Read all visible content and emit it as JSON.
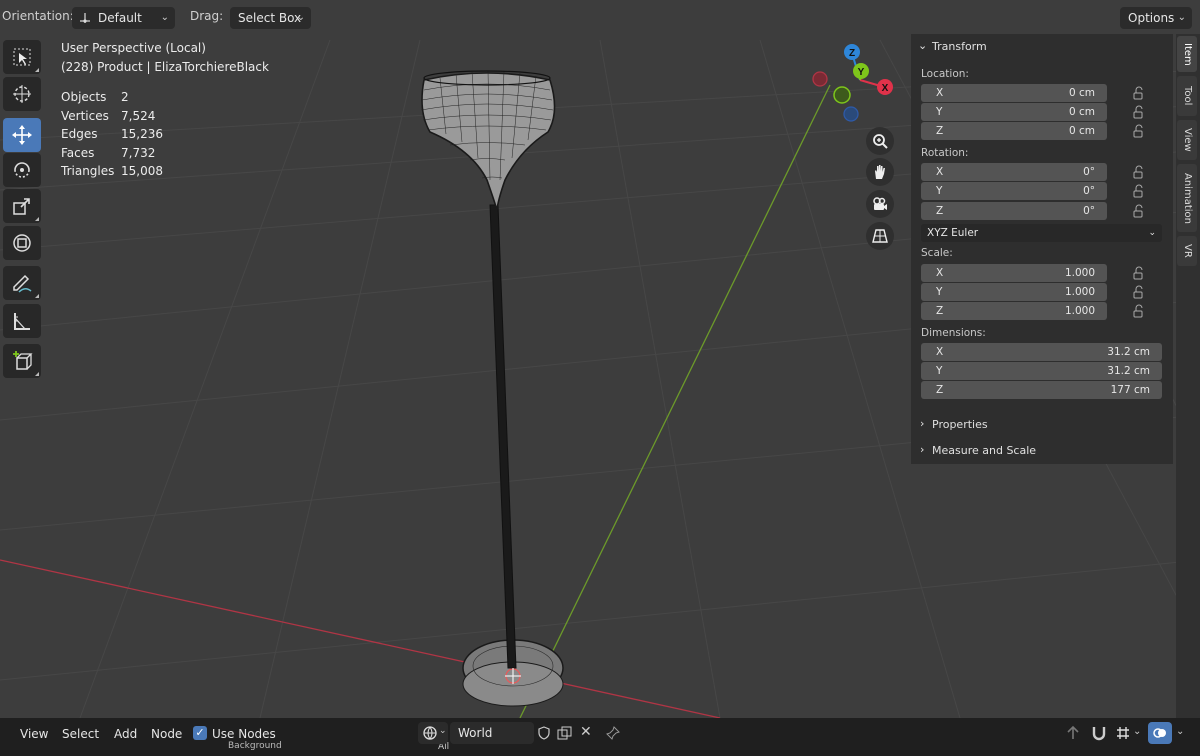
{
  "header": {
    "orientation_label": "Orientation:",
    "orientation_value": "Default",
    "drag_label": "Drag:",
    "drag_value": "Select Box",
    "options_label": "Options"
  },
  "overlay": {
    "view_name": "User Perspective (Local)",
    "object_name": "(228) Product | ElizaTorchiereBlack",
    "stats": [
      {
        "label": "Objects",
        "value": "2"
      },
      {
        "label": "Vertices",
        "value": "7,524"
      },
      {
        "label": "Edges",
        "value": "15,236"
      },
      {
        "label": "Faces",
        "value": "7,732"
      },
      {
        "label": "Triangles",
        "value": "15,008"
      }
    ]
  },
  "gizmo": {
    "x": "X",
    "y": "Y",
    "z": "Z"
  },
  "sidebar": {
    "transform_title": "Transform",
    "location_label": "Location:",
    "location": [
      {
        "axis": "X",
        "value": "0 cm"
      },
      {
        "axis": "Y",
        "value": "0 cm"
      },
      {
        "axis": "Z",
        "value": "0 cm"
      }
    ],
    "rotation_label": "Rotation:",
    "rotation": [
      {
        "axis": "X",
        "value": "0°"
      },
      {
        "axis": "Y",
        "value": "0°"
      },
      {
        "axis": "Z",
        "value": "0°"
      }
    ],
    "rotation_mode": "XYZ Euler",
    "scale_label": "Scale:",
    "scale": [
      {
        "axis": "X",
        "value": "1.000"
      },
      {
        "axis": "Y",
        "value": "1.000"
      },
      {
        "axis": "Z",
        "value": "1.000"
      }
    ],
    "dimensions_label": "Dimensions:",
    "dimensions": [
      {
        "axis": "X",
        "value": "31.2 cm"
      },
      {
        "axis": "Y",
        "value": "31.2 cm"
      },
      {
        "axis": "Z",
        "value": "177 cm"
      }
    ],
    "properties_title": "Properties",
    "measure_title": "Measure and Scale"
  },
  "tabs": [
    "Item",
    "Tool",
    "View",
    "Animation",
    "VR"
  ],
  "bottombar": {
    "view": "View",
    "select": "Select",
    "add": "Add",
    "node": "Node",
    "use_nodes": "Use Nodes",
    "world_value": "World",
    "background_node": "Background",
    "all_value": "All"
  },
  "colors": {
    "x_axis": "#e0324a",
    "y_axis": "#7ec61b",
    "z_axis": "#2e86d9",
    "active_tool": "#4a79b8"
  }
}
